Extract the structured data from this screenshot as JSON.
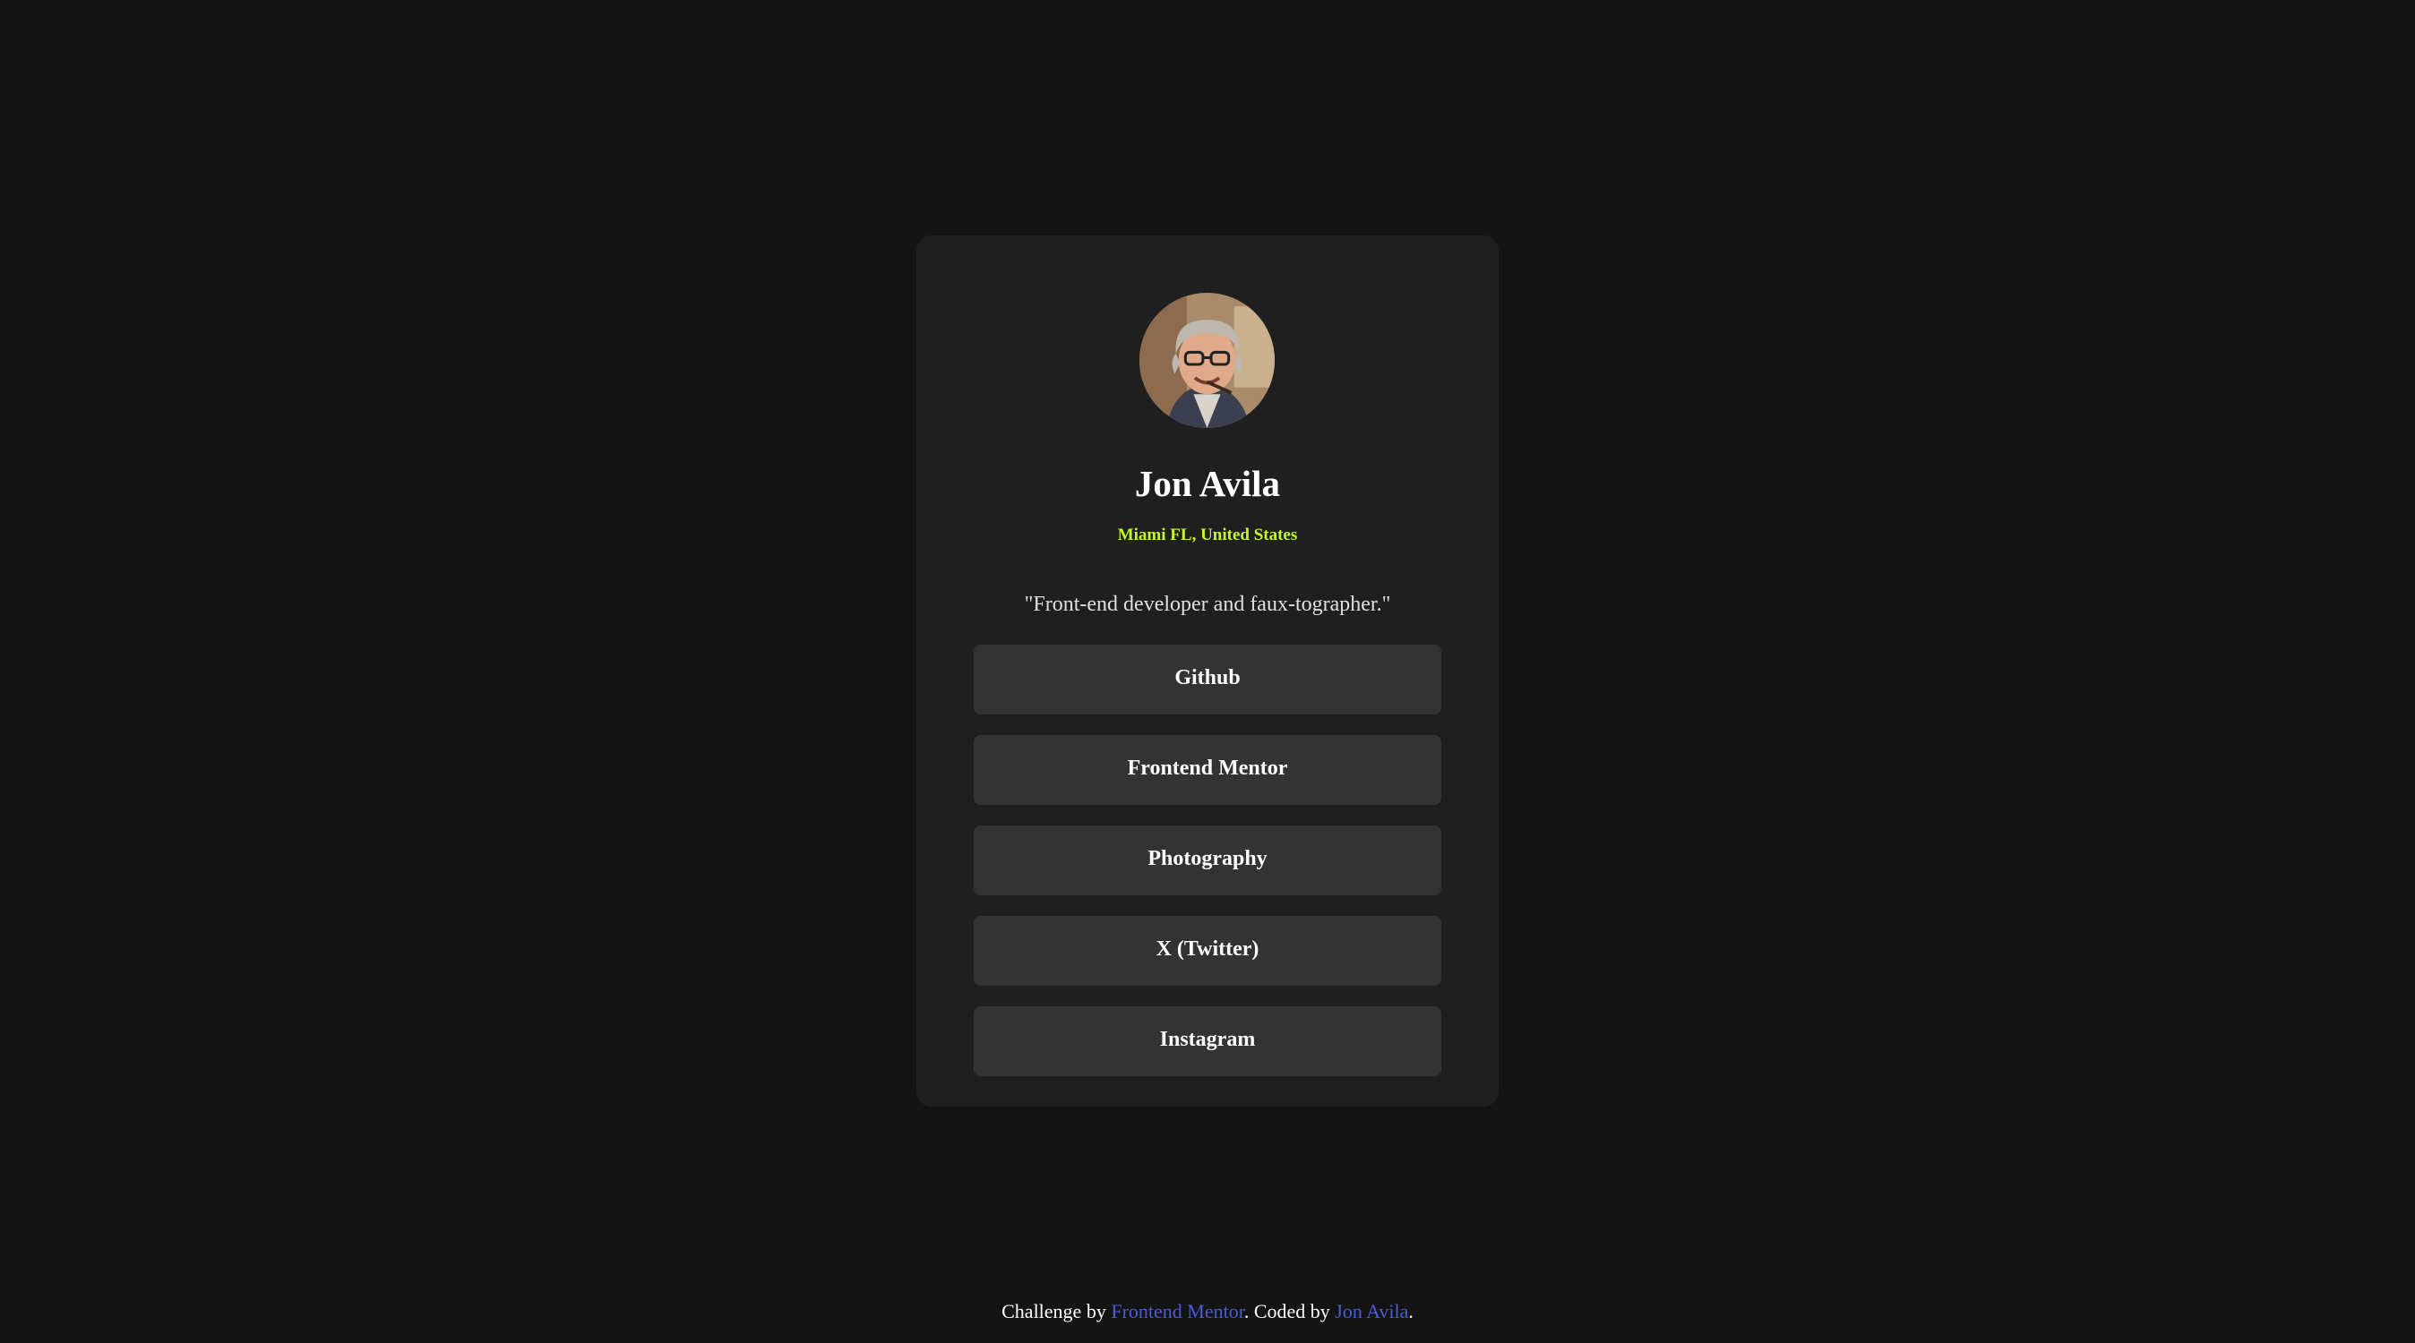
{
  "profile": {
    "name": "Jon Avila",
    "location": "Miami FL, United States",
    "bio": "\"Front-end developer and faux-tographer.\""
  },
  "links": [
    {
      "label": "Github"
    },
    {
      "label": "Frontend Mentor"
    },
    {
      "label": "Photography"
    },
    {
      "label": "X (Twitter)"
    },
    {
      "label": "Instagram"
    }
  ],
  "footer": {
    "prefix": "Challenge by ",
    "challenge_link": "Frontend Mentor",
    "middle": ". Coded by ",
    "author_link": "Jon Avila",
    "suffix": "."
  },
  "colors": {
    "page_background": "#141414",
    "card_background": "#1f1f1f",
    "button_background": "#333333",
    "accent": "#c4f82a",
    "link": "#4a5bd4"
  }
}
